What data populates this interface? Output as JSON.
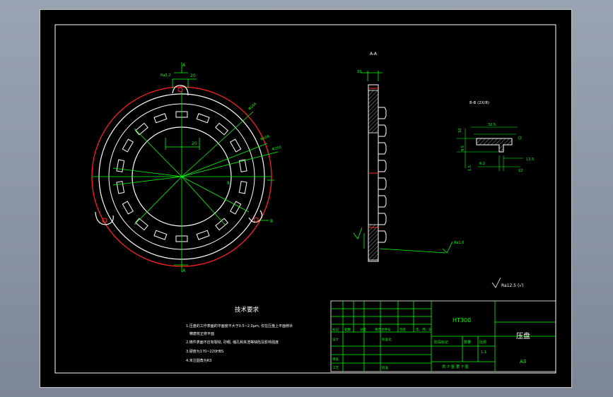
{
  "section_a": "A-A",
  "section_b": "B-B (2X/8)",
  "dims": {
    "d20_top": "20",
    "d20_inner": "20",
    "phi_a": "Φ166",
    "phi_b": "Φ456",
    "phi_c": "Φ250",
    "d8": "8",
    "d15_side": "15",
    "d325": "32.5",
    "d95": "9.5",
    "d10": "10",
    "d135": "13.5",
    "d12": "12",
    "d15b": "1.5",
    "d62": "6.2",
    "ra32": "Ra3.2",
    "ra64": "Ra1.6",
    "ra_gen": "Ra12.5 (√)",
    "label_a_top": "A",
    "label_a_bot": "A",
    "label_b": "B",
    "label_b2": "B"
  },
  "tech": {
    "title": "技术要求",
    "line1": "1.压盘的工作表面的平面度不大于0.5~2.0μm, 仅在压盘上平面修补",
    "line1b": "精磨校正修平面",
    "line2": "2.铸件表面不应有裂纹, 砂眼, 缩孔和夹渣等缺陷及影响强度",
    "line3": "3.硬度为170~220HBS",
    "line4": "4.未注圆角为R3"
  },
  "title_block": {
    "material": "HT300",
    "part_name": "压盘",
    "drawing_no": "A3",
    "sheet": "共 7 张  第 7 张",
    "scale_label": "比例",
    "scale": "1:1",
    "qty_label": "数量",
    "stage_label": "阶段标记",
    "col_mark": "标记",
    "col_count": "处数",
    "col_zone": "分区",
    "col_doc": "更改文件号",
    "col_sign": "签名",
    "col_date": "年、月、日",
    "designer": "设计",
    "standard": "标准化",
    "review": "审核",
    "process": "工艺",
    "approve": "批准"
  }
}
